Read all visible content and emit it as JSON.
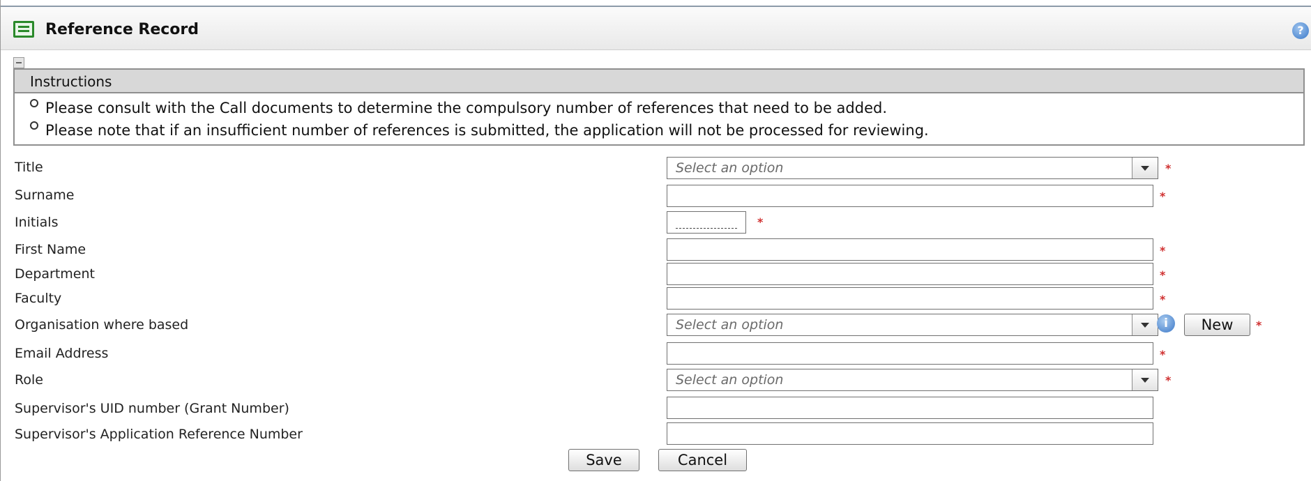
{
  "window": {
    "title": "Reference Record",
    "icons": {
      "title": "form-list-icon",
      "help": "help-icon",
      "collapse": "collapse-icon",
      "info": "info-icon"
    }
  },
  "instructions": {
    "heading": "Instructions",
    "items": [
      "Please consult with the Call documents to determine the compulsory number of references that need to be added.",
      "Please note that if an insufficient number of references is submitted, the application will not be processed for reviewing."
    ]
  },
  "form": {
    "title": {
      "label": "Title",
      "placeholder": "Select an option",
      "required": "*"
    },
    "surname": {
      "label": "Surname",
      "value": "",
      "required": "*"
    },
    "initials": {
      "label": "Initials",
      "value": "",
      "required": "*"
    },
    "first_name": {
      "label": "First Name",
      "value": "",
      "required": "*"
    },
    "department": {
      "label": "Department",
      "value": "",
      "required": "*"
    },
    "faculty": {
      "label": "Faculty",
      "value": "",
      "required": "*"
    },
    "organisation": {
      "label": "Organisation where based",
      "placeholder": "Select an option",
      "new_label": "New",
      "required": "*"
    },
    "email": {
      "label": "Email Address",
      "value": "",
      "required": "*"
    },
    "role": {
      "label": "Role",
      "placeholder": "Select an option",
      "required": "*"
    },
    "supervisor_uid": {
      "label": "Supervisor's UID number (Grant Number)",
      "value": ""
    },
    "supervisor_app_ref": {
      "label": "Supervisor's Application Reference Number",
      "value": ""
    }
  },
  "actions": {
    "save_label": "Save",
    "cancel_label": "Cancel"
  },
  "colors": {
    "required": "#d03030",
    "header_bg": "#d8d8d8",
    "border": "#8f8f8f",
    "title_icon": "#2b8a2b",
    "info": "#3b78c8"
  }
}
